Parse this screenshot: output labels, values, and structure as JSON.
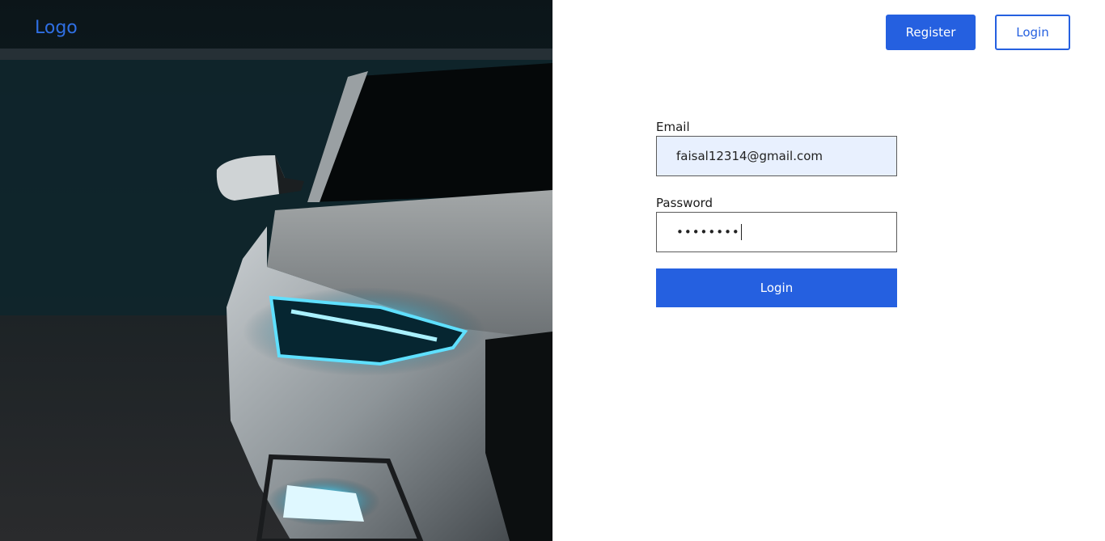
{
  "header": {
    "logo": "Logo",
    "register_label": "Register",
    "login_label": "Login"
  },
  "hero": {
    "image": "car-headlight-photo"
  },
  "form": {
    "email_label": "Email",
    "email_value": "faisal12314@gmail.com",
    "password_label": "Password",
    "password_value": "••••••••",
    "submit_label": "Login"
  },
  "colors": {
    "primary": "#2560e0",
    "logo": "#2f6fe3",
    "autofill_bg": "#e8f0fe"
  }
}
